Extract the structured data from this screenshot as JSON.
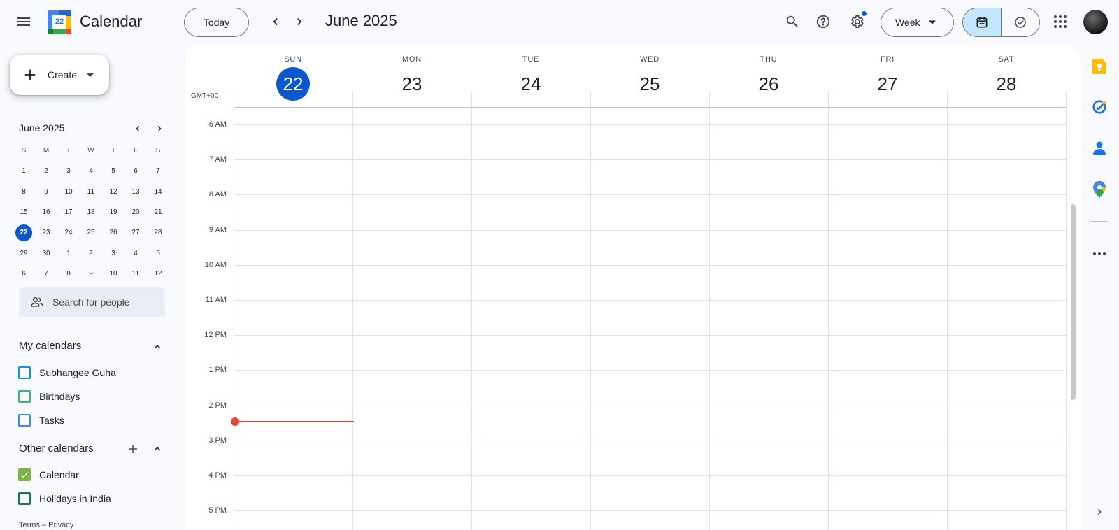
{
  "header": {
    "app_title": "Calendar",
    "logo_day": "22",
    "today_label": "Today",
    "period_title": "June 2025",
    "view_label": "Week"
  },
  "sidebar": {
    "create_label": "Create",
    "mini_calendar": {
      "title": "June 2025",
      "weekday_headers": [
        "S",
        "M",
        "T",
        "W",
        "T",
        "F",
        "S"
      ],
      "weeks": [
        [
          "1",
          "2",
          "3",
          "4",
          "5",
          "6",
          "7"
        ],
        [
          "8",
          "9",
          "10",
          "11",
          "12",
          "13",
          "14"
        ],
        [
          "15",
          "16",
          "17",
          "18",
          "19",
          "20",
          "21"
        ],
        [
          "22",
          "23",
          "24",
          "25",
          "26",
          "27",
          "28"
        ],
        [
          "29",
          "30",
          "1",
          "2",
          "3",
          "4",
          "5"
        ],
        [
          "6",
          "7",
          "8",
          "9",
          "10",
          "11",
          "12"
        ]
      ],
      "selected_day": "22"
    },
    "people_search_placeholder": "Search for people",
    "my_calendars": {
      "title": "My calendars",
      "items": [
        {
          "label": "Subhangee Guha",
          "color": "#039be5",
          "checked": false
        },
        {
          "label": "Birthdays",
          "color": "#33b679",
          "checked": false
        },
        {
          "label": "Tasks",
          "color": "#4285f4",
          "checked": false
        }
      ]
    },
    "other_calendars": {
      "title": "Other calendars",
      "items": [
        {
          "label": "Calendar",
          "color": "#7cb342",
          "checked": true
        },
        {
          "label": "Holidays in India",
          "color": "#0b8043",
          "checked": false
        }
      ]
    },
    "footer": "Terms – Privacy"
  },
  "week": {
    "timezone": "GMT+00",
    "days": [
      {
        "name": "SUN",
        "num": "22",
        "today": true
      },
      {
        "name": "MON",
        "num": "23",
        "today": false
      },
      {
        "name": "TUE",
        "num": "24",
        "today": false
      },
      {
        "name": "WED",
        "num": "25",
        "today": false
      },
      {
        "name": "THU",
        "num": "26",
        "today": false
      },
      {
        "name": "FRI",
        "num": "27",
        "today": false
      },
      {
        "name": "SAT",
        "num": "28",
        "today": false
      }
    ],
    "hours": [
      "6 AM",
      "7 AM",
      "8 AM",
      "9 AM",
      "10 AM",
      "11 AM",
      "12 PM",
      "1 PM",
      "2 PM",
      "3 PM",
      "4 PM",
      "5 PM"
    ]
  },
  "colors": {
    "accent": "#0b57d0",
    "current_time": "#ea4335",
    "selected_segment": "#c2e7ff"
  },
  "side_panel": {
    "apps": [
      "keep-icon",
      "tasks-icon",
      "contacts-icon",
      "maps-icon",
      "more-icon"
    ]
  }
}
